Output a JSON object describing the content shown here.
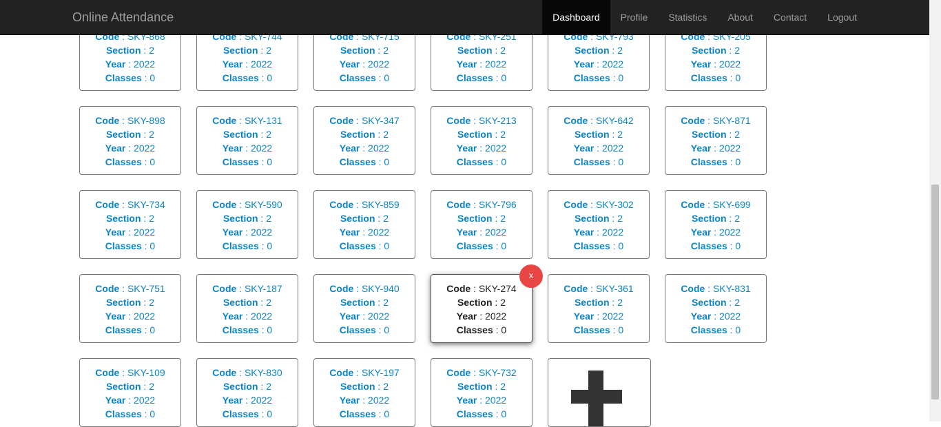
{
  "navbar": {
    "brand": "Online Attendance",
    "items": [
      {
        "label": "Dashboard",
        "active": true
      },
      {
        "label": "Profile"
      },
      {
        "label": "Statistics"
      },
      {
        "label": "About"
      },
      {
        "label": "Contact"
      },
      {
        "label": "Logout"
      }
    ]
  },
  "labels": {
    "code": "Code",
    "section": "Section",
    "year": "Year",
    "classes": "Classes"
  },
  "delete_label": "x",
  "classes": [
    {
      "code": "SKY-868",
      "section": "2",
      "year": "2022",
      "classes": "0"
    },
    {
      "code": "SKY-744",
      "section": "2",
      "year": "2022",
      "classes": "0"
    },
    {
      "code": "SKY-715",
      "section": "2",
      "year": "2022",
      "classes": "0"
    },
    {
      "code": "SKY-251",
      "section": "2",
      "year": "2022",
      "classes": "0"
    },
    {
      "code": "SKY-793",
      "section": "2",
      "year": "2022",
      "classes": "0"
    },
    {
      "code": "SKY-205",
      "section": "2",
      "year": "2022",
      "classes": "0"
    },
    {
      "code": "SKY-898",
      "section": "2",
      "year": "2022",
      "classes": "0"
    },
    {
      "code": "SKY-131",
      "section": "2",
      "year": "2022",
      "classes": "0"
    },
    {
      "code": "SKY-347",
      "section": "2",
      "year": "2022",
      "classes": "0"
    },
    {
      "code": "SKY-213",
      "section": "2",
      "year": "2022",
      "classes": "0"
    },
    {
      "code": "SKY-642",
      "section": "2",
      "year": "2022",
      "classes": "0"
    },
    {
      "code": "SKY-871",
      "section": "2",
      "year": "2022",
      "classes": "0"
    },
    {
      "code": "SKY-734",
      "section": "2",
      "year": "2022",
      "classes": "0"
    },
    {
      "code": "SKY-590",
      "section": "2",
      "year": "2022",
      "classes": "0"
    },
    {
      "code": "SKY-859",
      "section": "2",
      "year": "2022",
      "classes": "0"
    },
    {
      "code": "SKY-796",
      "section": "2",
      "year": "2022",
      "classes": "0"
    },
    {
      "code": "SKY-302",
      "section": "2",
      "year": "2022",
      "classes": "0"
    },
    {
      "code": "SKY-699",
      "section": "2",
      "year": "2022",
      "classes": "0"
    },
    {
      "code": "SKY-751",
      "section": "2",
      "year": "2022",
      "classes": "0"
    },
    {
      "code": "SKY-187",
      "section": "2",
      "year": "2022",
      "classes": "0"
    },
    {
      "code": "SKY-940",
      "section": "2",
      "year": "2022",
      "classes": "0"
    },
    {
      "code": "SKY-274",
      "section": "2",
      "year": "2022",
      "classes": "0",
      "selected": true
    },
    {
      "code": "SKY-361",
      "section": "2",
      "year": "2022",
      "classes": "0"
    },
    {
      "code": "SKY-831",
      "section": "2",
      "year": "2022",
      "classes": "0"
    },
    {
      "code": "SKY-109",
      "section": "2",
      "year": "2022",
      "classes": "0"
    },
    {
      "code": "SKY-830",
      "section": "2",
      "year": "2022",
      "classes": "0"
    },
    {
      "code": "SKY-197",
      "section": "2",
      "year": "2022",
      "classes": "0"
    },
    {
      "code": "SKY-732",
      "section": "2",
      "year": "2022",
      "classes": "0"
    }
  ],
  "colors": {
    "accent": "#0b84c6",
    "navbar": "#222222",
    "delete": "#e84545"
  }
}
